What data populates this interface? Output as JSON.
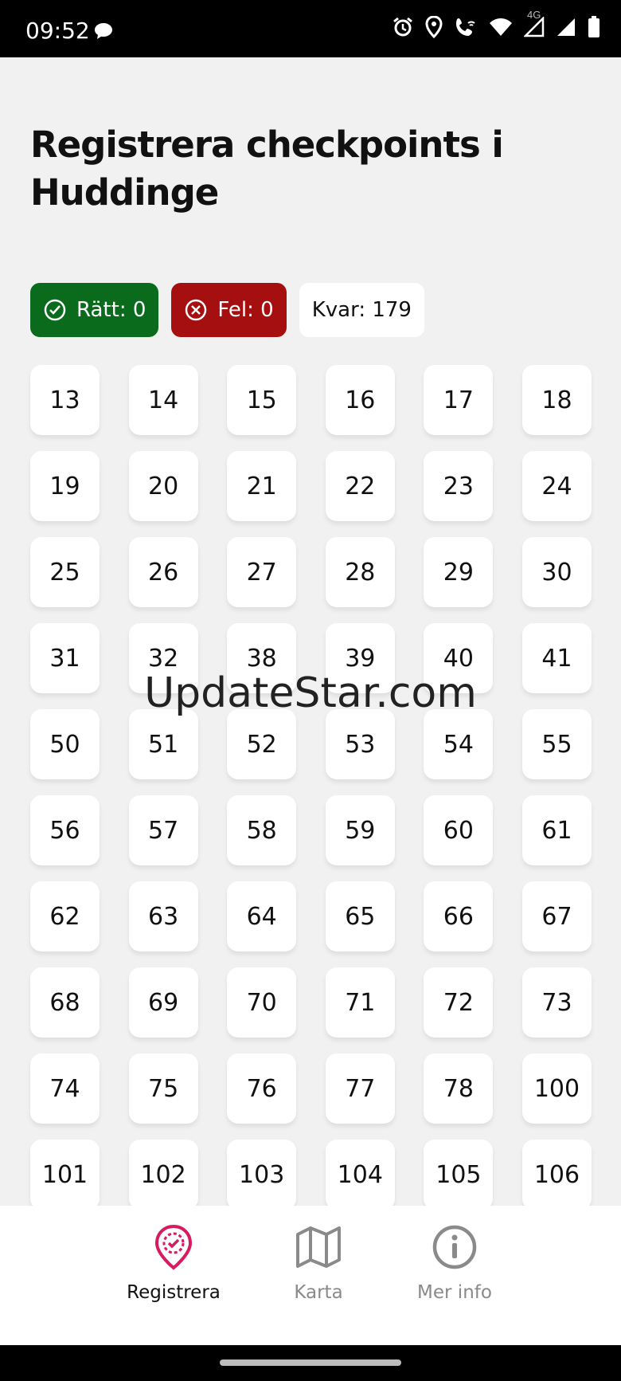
{
  "status_bar": {
    "time": "09:52",
    "network": "4G",
    "icons": [
      "chat-bubble-icon",
      "alarm-icon",
      "location-icon",
      "wifi-call-icon",
      "wifi-icon",
      "signal-icon",
      "signal-icon",
      "battery-icon"
    ]
  },
  "page": {
    "title": "Registrera checkpoints i Huddinge"
  },
  "badges": {
    "ratt": "Rätt: 0",
    "fel": "Fel: 0",
    "kvar": "Kvar: 179"
  },
  "checkpoints": [
    "13",
    "14",
    "15",
    "16",
    "17",
    "18",
    "19",
    "20",
    "21",
    "22",
    "23",
    "24",
    "25",
    "26",
    "27",
    "28",
    "29",
    "30",
    "31",
    "32",
    "38",
    "39",
    "40",
    "41",
    "50",
    "51",
    "52",
    "53",
    "54",
    "55",
    "56",
    "57",
    "58",
    "59",
    "60",
    "61",
    "62",
    "63",
    "64",
    "65",
    "66",
    "67",
    "68",
    "69",
    "70",
    "71",
    "72",
    "73",
    "74",
    "75",
    "76",
    "77",
    "78",
    "100",
    "101",
    "102",
    "103",
    "104",
    "105",
    "106"
  ],
  "watermark": "UpdateStar.com",
  "nav": {
    "registrera": "Registrera",
    "karta": "Karta",
    "mer_info": "Mer info"
  },
  "colors": {
    "accent": "#d81b60",
    "ratt_bg": "#0b6b1c",
    "fel_bg": "#a50f0f",
    "inactive": "#8a8a8a"
  }
}
